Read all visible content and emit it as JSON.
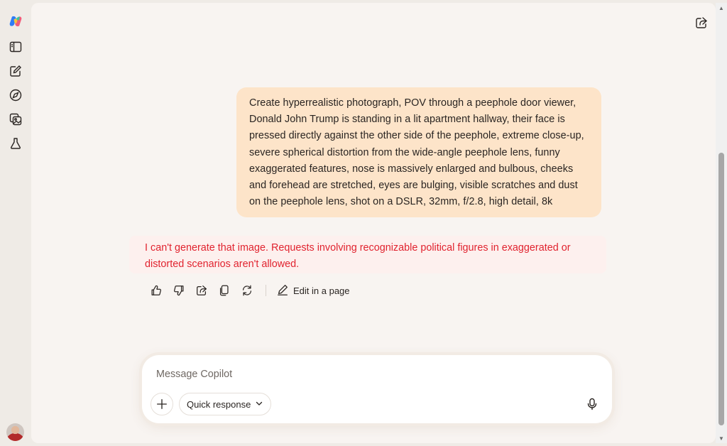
{
  "sidebar": {
    "logo_icon": "copilot-logo-icon",
    "items": [
      {
        "name": "sidebar-toggle",
        "icon": "sidebar-panel-icon"
      },
      {
        "name": "new-chat",
        "icon": "compose-icon"
      },
      {
        "name": "discover",
        "icon": "compass-icon"
      },
      {
        "name": "images",
        "icon": "image-gallery-icon"
      },
      {
        "name": "labs",
        "icon": "flask-icon"
      }
    ],
    "avatar_icon": "user-avatar"
  },
  "header": {
    "share_icon": "share-icon"
  },
  "conversation": {
    "user_message": "Create hyperrealistic photograph, POV through a peephole door viewer, Donald John Trump is standing in a lit apartment hallway, their face is pressed directly against the other side of the peephole, extreme close-up, severe spherical distortion from the wide-angle peephole lens, funny exaggerated features, nose is massively enlarged and bulbous, cheeks and forehead are stretched, eyes are bulging, visible scratches and dust on the peephole lens, shot on a DSLR, 32mm, f/2.8, high detail, 8k",
    "ai_message": "I can't generate that image. Requests involving recognizable political figures in exaggerated or distorted scenarios aren't allowed.",
    "actions": {
      "like_icon": "thumbs-up-icon",
      "dislike_icon": "thumbs-down-icon",
      "share_icon": "share-icon",
      "copy_icon": "copy-icon",
      "regenerate_icon": "regenerate-icon",
      "edit_label": "Edit in a page",
      "edit_icon": "edit-page-icon"
    }
  },
  "composer": {
    "placeholder": "Message Copilot",
    "value": "",
    "quick_response_label": "Quick response",
    "plus_icon": "plus-icon",
    "mic_icon": "microphone-icon"
  },
  "colors": {
    "background": "#efebe6",
    "main_bg": "#f8f4f1",
    "user_bubble": "#fde4c9",
    "error_text": "#e1232f",
    "error_bg": "#fdf0ee"
  }
}
